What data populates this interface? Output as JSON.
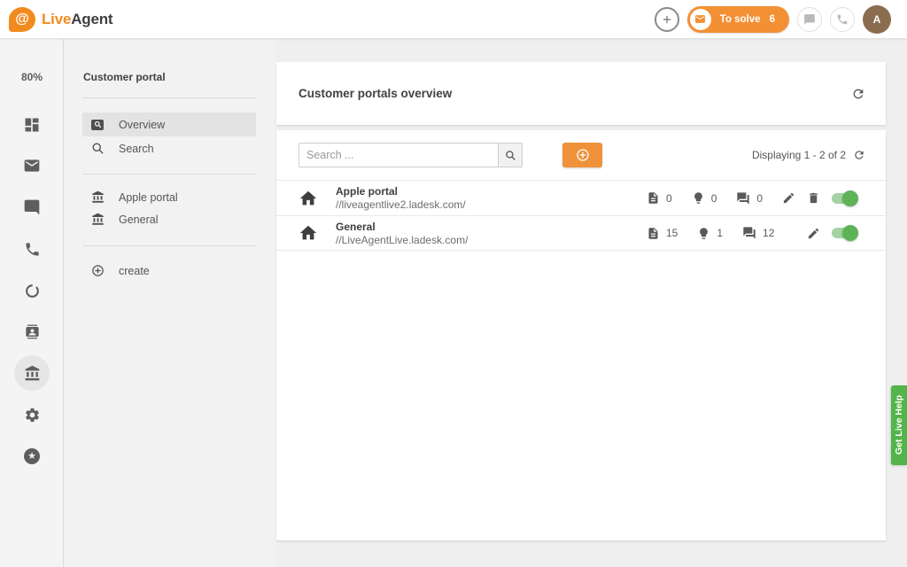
{
  "app": {
    "logo_live": "Live",
    "logo_agent": "Agent",
    "logo_at": "@",
    "topbar": {
      "to_solve_label": "To solve",
      "to_solve_count": "6",
      "avatar_letter": "A"
    }
  },
  "icon_rail": {
    "zoom_level": "80%",
    "items": [
      "dashboard",
      "mail",
      "chat",
      "phone",
      "status-ring",
      "contacts",
      "customer-portal",
      "settings",
      "star"
    ]
  },
  "portal_nav": {
    "title": "Customer portal",
    "overview_label": "Overview",
    "search_label": "Search",
    "apple_portal_label": "Apple portal",
    "general_label": "General",
    "create_label": "create"
  },
  "main": {
    "title": "Customer portals overview",
    "search_placeholder": "Search ...",
    "displaying": "Displaying 1 - 2 of 2",
    "rows": [
      {
        "name": "Apple portal",
        "url": "//liveagentlive2.ladesk.com/",
        "articles": "0",
        "suggestions": "0",
        "forum_posts": "0",
        "enabled": true
      },
      {
        "name": "General",
        "url": "//LiveAgentLive.ladesk.com/",
        "articles": "15",
        "suggestions": "1",
        "forum_posts": "12",
        "enabled": true
      }
    ]
  },
  "help_tab": {
    "label": "Get Live Help"
  },
  "colors": {
    "accent_orange": "#f39034",
    "success_green": "#52b44b",
    "avatar_brown": "#8a6d4f",
    "toggle_track": "#a3d3a3",
    "toggle_knob": "#5cb457"
  }
}
